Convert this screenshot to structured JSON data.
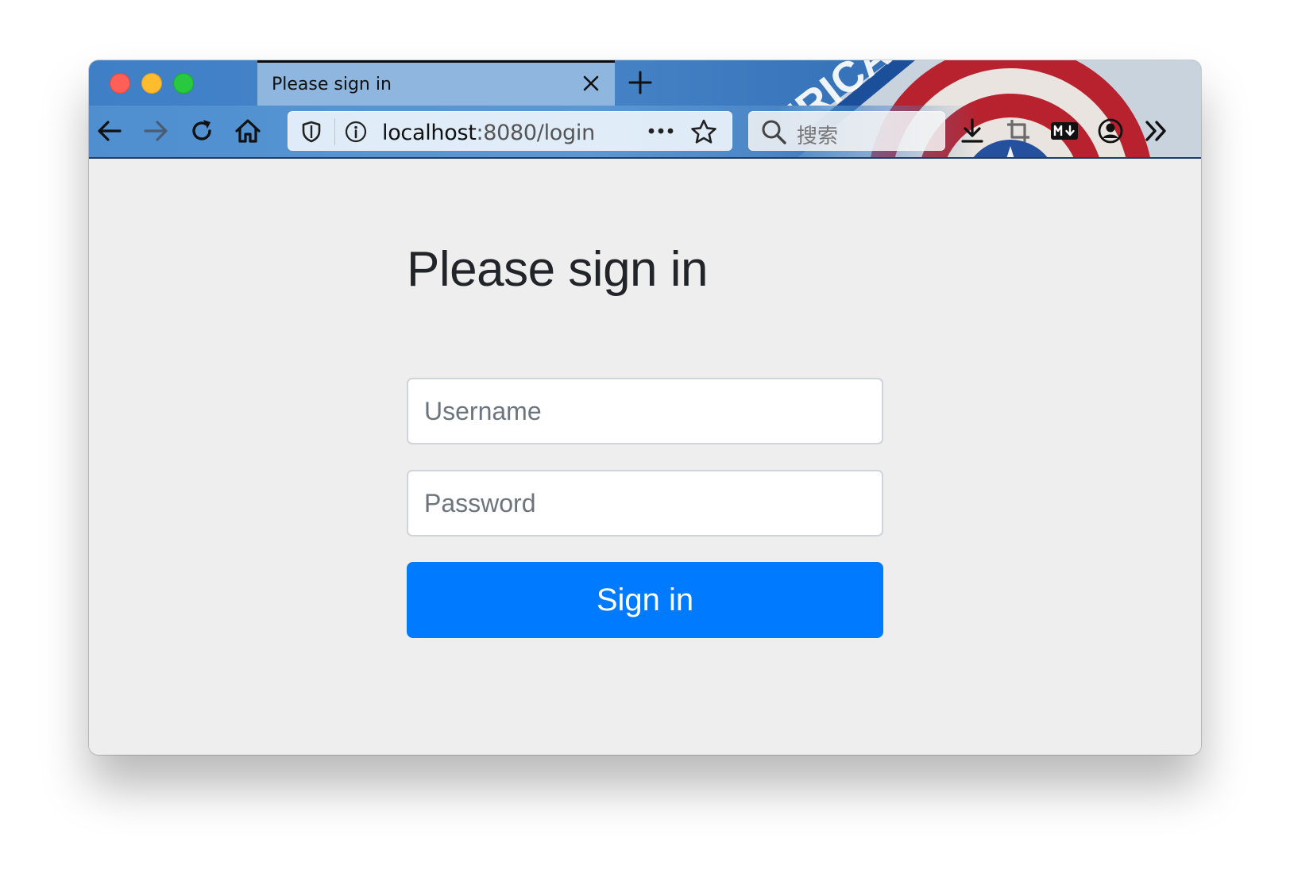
{
  "window": {
    "traffic_lights": [
      "close",
      "minimize",
      "maximize"
    ]
  },
  "tab": {
    "title": "Please sign in",
    "close_icon": "close-icon"
  },
  "new_tab_icon": "plus-icon",
  "toolbar": {
    "url_host": "localhost",
    "url_rest": ":8080/login",
    "search_placeholder": "搜索",
    "icons": [
      "back-icon",
      "forward-icon",
      "reload-icon",
      "home-icon",
      "shield-icon",
      "info-icon",
      "more-icon",
      "star-icon",
      "search-icon",
      "download-icon",
      "crop-icon",
      "markdown-icon",
      "account-icon",
      "overflow-icon"
    ]
  },
  "page": {
    "heading": "Please sign in",
    "username_placeholder": "Username",
    "password_placeholder": "Password",
    "signin_label": "Sign in"
  },
  "colors": {
    "accent": "#007bff",
    "page_background": "#eeeeee",
    "heading_text": "#212529"
  }
}
